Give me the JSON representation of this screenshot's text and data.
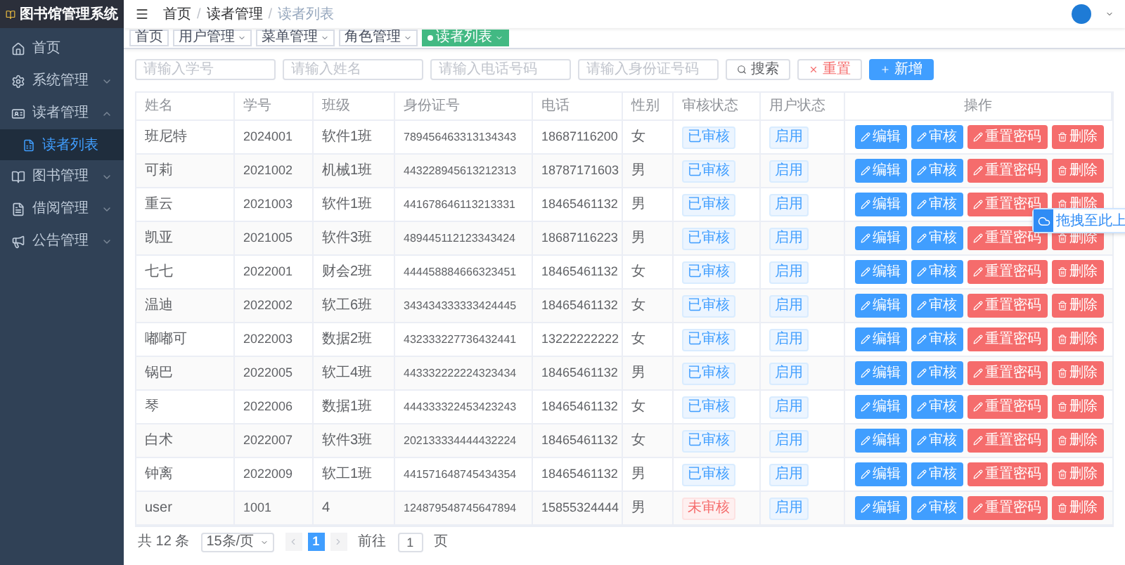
{
  "app": {
    "title": "图书馆管理系统"
  },
  "sidebar": {
    "items": [
      {
        "label": "首页",
        "has_children": false
      },
      {
        "label": "系统管理",
        "expanded": false,
        "has_children": true
      },
      {
        "label": "读者管理",
        "expanded": true,
        "has_children": true,
        "children": [
          {
            "label": "读者列表",
            "selected": true
          }
        ]
      },
      {
        "label": "图书管理",
        "expanded": false,
        "has_children": true
      },
      {
        "label": "借阅管理",
        "expanded": false,
        "has_children": true
      },
      {
        "label": "公告管理",
        "expanded": false,
        "has_children": true
      }
    ]
  },
  "breadcrumb": {
    "separator": "/",
    "items": [
      "首页",
      "读者管理",
      "读者列表"
    ]
  },
  "tags": [
    {
      "label": "首页",
      "selected": false,
      "closable": false
    },
    {
      "label": "用户管理",
      "selected": false,
      "closable": true
    },
    {
      "label": "菜单管理",
      "selected": false,
      "closable": true
    },
    {
      "label": "角色管理",
      "selected": false,
      "closable": true
    },
    {
      "label": "读者列表",
      "selected": true,
      "closable": true
    }
  ],
  "search": {
    "fields": [
      {
        "placeholder": "请输入学号"
      },
      {
        "placeholder": "请输入姓名"
      },
      {
        "placeholder": "请输入电话号码"
      },
      {
        "placeholder": "请输入身份证号码"
      }
    ],
    "buttons": [
      {
        "label": "搜索",
        "kind": "search"
      },
      {
        "label": "重置",
        "kind": "reset"
      },
      {
        "label": "新增",
        "kind": "add"
      }
    ]
  },
  "table": {
    "columns": [
      "姓名",
      "学号",
      "班级",
      "身份证号",
      "电话",
      "性别",
      "审核状态",
      "用户状态",
      "操作"
    ],
    "rows": [
      {
        "cells": [
          "班尼特",
          "2024001",
          "软件1班",
          "789456463313134343",
          "18687116200",
          "女"
        ],
        "review": {
          "text": "已审核",
          "kind": "approved"
        },
        "status": "启用",
        "actions": [
          {
            "label": "编辑",
            "kind": "edit"
          },
          {
            "label": "审核",
            "kind": "audit"
          },
          {
            "label": "重置密码",
            "kind": "reset"
          },
          {
            "label": "删除",
            "kind": "delete"
          }
        ]
      },
      {
        "cells": [
          "可莉",
          "2021002",
          "机械1班",
          "443228945613212313",
          "18787171603",
          "男"
        ],
        "review": {
          "text": "已审核",
          "kind": "approved"
        },
        "status": "启用",
        "actions": [
          {
            "label": "编辑",
            "kind": "edit"
          },
          {
            "label": "审核",
            "kind": "audit"
          },
          {
            "label": "重置密码",
            "kind": "reset"
          },
          {
            "label": "删除",
            "kind": "delete"
          }
        ]
      },
      {
        "cells": [
          "重云",
          "2021003",
          "软件1班",
          "441678646113213331",
          "18465461132",
          "男"
        ],
        "review": {
          "text": "已审核",
          "kind": "approved"
        },
        "status": "启用",
        "actions": [
          {
            "label": "编辑",
            "kind": "edit"
          },
          {
            "label": "审核",
            "kind": "audit"
          },
          {
            "label": "重置密码",
            "kind": "reset"
          },
          {
            "label": "删除",
            "kind": "delete"
          }
        ]
      },
      {
        "cells": [
          "凯亚",
          "2021005",
          "软件3班",
          "489445112123343424",
          "18687116223",
          "男"
        ],
        "review": {
          "text": "已审核",
          "kind": "approved"
        },
        "status": "启用",
        "actions": [
          {
            "label": "编辑",
            "kind": "edit"
          },
          {
            "label": "审核",
            "kind": "audit"
          },
          {
            "label": "重置密码",
            "kind": "reset"
          },
          {
            "label": "删除",
            "kind": "delete"
          }
        ]
      },
      {
        "cells": [
          "七七",
          "2022001",
          "财会2班",
          "444458884666323451",
          "18465461132",
          "女"
        ],
        "review": {
          "text": "已审核",
          "kind": "approved"
        },
        "status": "启用",
        "actions": [
          {
            "label": "编辑",
            "kind": "edit"
          },
          {
            "label": "审核",
            "kind": "audit"
          },
          {
            "label": "重置密码",
            "kind": "reset"
          },
          {
            "label": "删除",
            "kind": "delete"
          }
        ]
      },
      {
        "cells": [
          "温迪",
          "2022002",
          "软工6班",
          "343434333333424445",
          "18465461132",
          "女"
        ],
        "review": {
          "text": "已审核",
          "kind": "approved"
        },
        "status": "启用",
        "actions": [
          {
            "label": "编辑",
            "kind": "edit"
          },
          {
            "label": "审核",
            "kind": "audit"
          },
          {
            "label": "重置密码",
            "kind": "reset"
          },
          {
            "label": "删除",
            "kind": "delete"
          }
        ]
      },
      {
        "cells": [
          "嘟嘟可",
          "2022003",
          "数据2班",
          "432333227736432441",
          "13222222222",
          "女"
        ],
        "review": {
          "text": "已审核",
          "kind": "approved"
        },
        "status": "启用",
        "actions": [
          {
            "label": "编辑",
            "kind": "edit"
          },
          {
            "label": "审核",
            "kind": "audit"
          },
          {
            "label": "重置密码",
            "kind": "reset"
          },
          {
            "label": "删除",
            "kind": "delete"
          }
        ]
      },
      {
        "cells": [
          "锅巴",
          "2022005",
          "软工4班",
          "443332222224323434",
          "18465461132",
          "男"
        ],
        "review": {
          "text": "已审核",
          "kind": "approved"
        },
        "status": "启用",
        "actions": [
          {
            "label": "编辑",
            "kind": "edit"
          },
          {
            "label": "审核",
            "kind": "audit"
          },
          {
            "label": "重置密码",
            "kind": "reset"
          },
          {
            "label": "删除",
            "kind": "delete"
          }
        ]
      },
      {
        "cells": [
          "琴",
          "2022006",
          "数据1班",
          "444333322453423243",
          "18465461132",
          "女"
        ],
        "review": {
          "text": "已审核",
          "kind": "approved"
        },
        "status": "启用",
        "actions": [
          {
            "label": "编辑",
            "kind": "edit"
          },
          {
            "label": "审核",
            "kind": "audit"
          },
          {
            "label": "重置密码",
            "kind": "reset"
          },
          {
            "label": "删除",
            "kind": "delete"
          }
        ]
      },
      {
        "cells": [
          "白术",
          "2022007",
          "软件3班",
          "202133334444432224",
          "18465461132",
          "女"
        ],
        "review": {
          "text": "已审核",
          "kind": "approved"
        },
        "status": "启用",
        "actions": [
          {
            "label": "编辑",
            "kind": "edit"
          },
          {
            "label": "审核",
            "kind": "audit"
          },
          {
            "label": "重置密码",
            "kind": "reset"
          },
          {
            "label": "删除",
            "kind": "delete"
          }
        ]
      },
      {
        "cells": [
          "钟离",
          "2022009",
          "软工1班",
          "441571648745434354",
          "18465461132",
          "男"
        ],
        "review": {
          "text": "已审核",
          "kind": "approved"
        },
        "status": "启用",
        "actions": [
          {
            "label": "编辑",
            "kind": "edit"
          },
          {
            "label": "审核",
            "kind": "audit"
          },
          {
            "label": "重置密码",
            "kind": "reset"
          },
          {
            "label": "删除",
            "kind": "delete"
          }
        ]
      },
      {
        "cells": [
          "user",
          "1001",
          "4",
          "124879548745647894",
          "15855324444",
          "男"
        ],
        "review": {
          "text": "未审核",
          "kind": "pending"
        },
        "status": "启用",
        "actions": [
          {
            "label": "编辑",
            "kind": "edit"
          },
          {
            "label": "审核",
            "kind": "audit"
          },
          {
            "label": "重置密码",
            "kind": "reset"
          },
          {
            "label": "删除",
            "kind": "delete"
          }
        ]
      }
    ]
  },
  "pagination": {
    "total": "共 12 条",
    "page_size": "15条/页",
    "pages": [
      {
        "label": "1",
        "selected": true
      }
    ],
    "goto_label": "前往",
    "goto_value": "1",
    "goto_suffix": "页"
  },
  "upload_widget": {
    "label": "拖拽至此上"
  }
}
